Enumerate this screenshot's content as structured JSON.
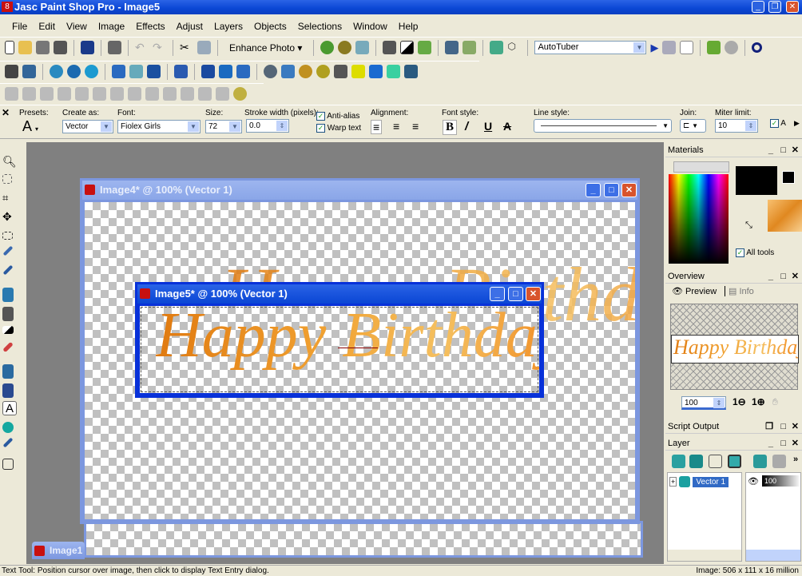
{
  "app": {
    "title": "Jasc Paint Shop Pro - Image5",
    "icon": "psp-icon-8"
  },
  "menu": [
    "File",
    "Edit",
    "View",
    "Image",
    "Effects",
    "Adjust",
    "Layers",
    "Objects",
    "Selections",
    "Window",
    "Help"
  ],
  "toolbar": {
    "enhance_photo": "Enhance Photo",
    "script_select": "AutoTuber"
  },
  "tool_options": {
    "presets_label": "Presets:",
    "create_as_label": "Create as:",
    "create_as_value": "Vector",
    "font_label": "Font:",
    "font_value": "Fiolex Girls",
    "size_label": "Size:",
    "size_value": "72",
    "stroke_label": "Stroke width (pixels):",
    "stroke_value": "0.0",
    "anti_alias_label": "Anti-alias",
    "anti_alias_checked": true,
    "warp_text_label": "Warp text",
    "warp_text_checked": true,
    "alignment_label": "Alignment:",
    "alignment_selected": "left",
    "font_style_label": "Font style:",
    "bold_active": true,
    "line_style_label": "Line style:",
    "join_label": "Join:",
    "miter_label": "Miter limit:",
    "miter_value": "10",
    "a_label": "A"
  },
  "windows": {
    "image4": {
      "title": "Image4* @ 100% (Vector 1)"
    },
    "image5": {
      "title": "Image5* @ 100% (Vector 1)"
    },
    "image1": {
      "title": "Image1"
    },
    "canvas_text": "Happy Birthday"
  },
  "materials": {
    "title": "Materials",
    "all_tools_label": "All tools",
    "all_tools_checked": true,
    "foreground_color": "#000000",
    "background_color": "#ffffff"
  },
  "overview": {
    "title": "Overview",
    "tab_preview": "Preview",
    "tab_info": "Info",
    "zoom_value": "100",
    "preview_text": "Happy Birthday"
  },
  "script_output": {
    "title": "Script Output"
  },
  "layer": {
    "title": "Layer",
    "layers": [
      {
        "name": "Vector 1",
        "opacity": "100",
        "visible": true
      }
    ]
  },
  "status": {
    "left": "Text Tool: Position cursor over image, then click to display Text Entry dialog.",
    "right": "Image:  506 x 111 x 16 million"
  }
}
